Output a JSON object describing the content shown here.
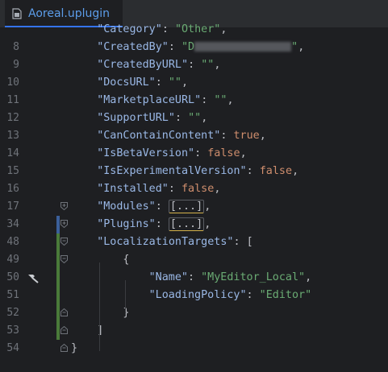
{
  "tab": {
    "filename": "Aoreal.uplugin",
    "icon": "plugin-file-icon"
  },
  "lines": [
    {
      "num": "",
      "indent": 4,
      "tokens": [
        {
          "t": "key",
          "v": "\"Category\""
        },
        {
          "t": "pun",
          "v": ": "
        },
        {
          "t": "str",
          "v": "\"Other\""
        },
        {
          "t": "pun",
          "v": ","
        }
      ]
    },
    {
      "num": "8",
      "indent": 4,
      "tokens": [
        {
          "t": "key",
          "v": "\"CreatedBy\""
        },
        {
          "t": "pun",
          "v": ": "
        },
        {
          "t": "str",
          "v": "\"D"
        },
        {
          "t": "redact",
          "v": ""
        },
        {
          "t": "str",
          "v": "\""
        },
        {
          "t": "pun",
          "v": ","
        }
      ]
    },
    {
      "num": "9",
      "indent": 4,
      "tokens": [
        {
          "t": "key",
          "v": "\"CreatedByURL\""
        },
        {
          "t": "pun",
          "v": ": "
        },
        {
          "t": "str",
          "v": "\"\""
        },
        {
          "t": "pun",
          "v": ","
        }
      ]
    },
    {
      "num": "10",
      "indent": 4,
      "tokens": [
        {
          "t": "key",
          "v": "\"DocsURL\""
        },
        {
          "t": "pun",
          "v": ": "
        },
        {
          "t": "str",
          "v": "\"\""
        },
        {
          "t": "pun",
          "v": ","
        }
      ]
    },
    {
      "num": "11",
      "indent": 4,
      "tokens": [
        {
          "t": "key",
          "v": "\"MarketplaceURL\""
        },
        {
          "t": "pun",
          "v": ": "
        },
        {
          "t": "str",
          "v": "\"\""
        },
        {
          "t": "pun",
          "v": ","
        }
      ]
    },
    {
      "num": "12",
      "indent": 4,
      "tokens": [
        {
          "t": "key",
          "v": "\"SupportURL\""
        },
        {
          "t": "pun",
          "v": ": "
        },
        {
          "t": "str",
          "v": "\"\""
        },
        {
          "t": "pun",
          "v": ","
        }
      ]
    },
    {
      "num": "13",
      "indent": 4,
      "tokens": [
        {
          "t": "key",
          "v": "\"CanContainContent\""
        },
        {
          "t": "pun",
          "v": ": "
        },
        {
          "t": "kw",
          "v": "true"
        },
        {
          "t": "pun",
          "v": ","
        }
      ]
    },
    {
      "num": "14",
      "indent": 4,
      "tokens": [
        {
          "t": "key",
          "v": "\"IsBetaVersion\""
        },
        {
          "t": "pun",
          "v": ": "
        },
        {
          "t": "kw",
          "v": "false"
        },
        {
          "t": "pun",
          "v": ","
        }
      ]
    },
    {
      "num": "15",
      "indent": 4,
      "tokens": [
        {
          "t": "key",
          "v": "\"IsExperimentalVersion\""
        },
        {
          "t": "pun",
          "v": ": "
        },
        {
          "t": "kw",
          "v": "false"
        },
        {
          "t": "pun",
          "v": ","
        }
      ]
    },
    {
      "num": "16",
      "indent": 4,
      "tokens": [
        {
          "t": "key",
          "v": "\"Installed\""
        },
        {
          "t": "pun",
          "v": ": "
        },
        {
          "t": "kw",
          "v": "false"
        },
        {
          "t": "pun",
          "v": ","
        }
      ]
    },
    {
      "num": "17",
      "indent": 4,
      "fold": "plus",
      "tokens": [
        {
          "t": "key",
          "v": "\"Modules\""
        },
        {
          "t": "pun",
          "v": ": "
        },
        {
          "t": "fold",
          "v": "[...]"
        },
        {
          "t": "pun",
          "v": ","
        }
      ]
    },
    {
      "num": "34",
      "indent": 4,
      "fold": "plus",
      "tokens": [
        {
          "t": "key",
          "v": "\"Plugins\""
        },
        {
          "t": "pun",
          "v": ": "
        },
        {
          "t": "fold",
          "v": "[...]"
        },
        {
          "t": "pun",
          "v": ","
        }
      ]
    },
    {
      "num": "48",
      "indent": 4,
      "fold": "minus",
      "tokens": [
        {
          "t": "key",
          "v": "\"LocalizationTargets\""
        },
        {
          "t": "pun",
          "v": ": ["
        }
      ]
    },
    {
      "num": "49",
      "indent": 8,
      "fold": "minus",
      "tokens": [
        {
          "t": "pun",
          "v": "{"
        }
      ]
    },
    {
      "num": "50",
      "indent": 12,
      "hammer": true,
      "tokens": [
        {
          "t": "key",
          "v": "\"Name\""
        },
        {
          "t": "pun",
          "v": ": "
        },
        {
          "t": "str",
          "v": "\"MyEditor_Local\""
        },
        {
          "t": "pun",
          "v": ","
        }
      ]
    },
    {
      "num": "51",
      "indent": 12,
      "tokens": [
        {
          "t": "key",
          "v": "\"LoadingPolicy\""
        },
        {
          "t": "pun",
          "v": ": "
        },
        {
          "t": "str",
          "v": "\"Editor\""
        }
      ]
    },
    {
      "num": "52",
      "indent": 8,
      "fold": "end",
      "tokens": [
        {
          "t": "pun",
          "v": "}"
        }
      ]
    },
    {
      "num": "53",
      "indent": 4,
      "fold": "end",
      "tokens": [
        {
          "t": "pun",
          "v": "]"
        }
      ]
    },
    {
      "num": "54",
      "indent": 0,
      "fold": "end",
      "tokens": [
        {
          "t": "pun",
          "v": "}"
        }
      ]
    }
  ],
  "colors": {
    "key": "#9ab8e6",
    "string": "#6aab73",
    "keyword": "#cf8e6d",
    "background": "#1e1f22"
  }
}
